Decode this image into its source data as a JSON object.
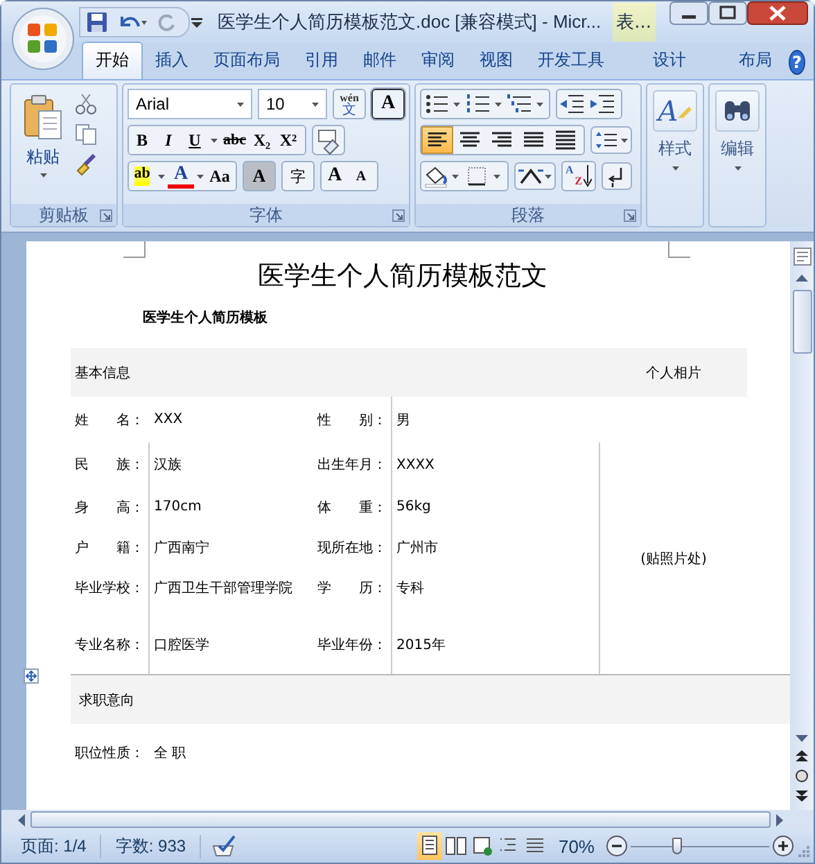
{
  "window": {
    "title": "医学生个人简历模板范文.doc [兼容模式] - Micr...",
    "context_group": "表..."
  },
  "tabs": [
    {
      "label": "开始",
      "selected": true,
      "kind": "main"
    },
    {
      "label": "插入",
      "selected": false,
      "kind": "main"
    },
    {
      "label": "页面布局",
      "selected": false,
      "kind": "main"
    },
    {
      "label": "引用",
      "selected": false,
      "kind": "main"
    },
    {
      "label": "邮件",
      "selected": false,
      "kind": "main"
    },
    {
      "label": "审阅",
      "selected": false,
      "kind": "main"
    },
    {
      "label": "视图",
      "selected": false,
      "kind": "main"
    },
    {
      "label": "开发工具",
      "selected": false,
      "kind": "main"
    },
    {
      "label": "设计",
      "selected": false,
      "kind": "context"
    },
    {
      "label": "布局",
      "selected": false,
      "kind": "context"
    }
  ],
  "ribbon": {
    "clipboard": {
      "label": "剪贴板",
      "paste": "粘贴"
    },
    "font": {
      "label": "字体",
      "font_name": "Arial",
      "font_size": "10",
      "phonetic_top": "wén",
      "phonetic_bottom": "文",
      "char_border": "A",
      "style_buttons": [
        "B",
        "I",
        "U",
        "abc",
        "X₂",
        "X²"
      ],
      "highlight": "ab",
      "font_color": "A",
      "change_case": "Aa",
      "char_shading": "A",
      "enclose": "字",
      "grow": "A",
      "shrink": "A"
    },
    "paragraph": {
      "label": "段落",
      "alignments": [
        {
          "selected": true
        },
        {
          "selected": false
        },
        {
          "selected": false
        },
        {
          "selected": false
        },
        {
          "selected": false
        }
      ],
      "sort_top": "A",
      "sort_bottom": "Z"
    },
    "styles": {
      "label": "样式",
      "icon_letter": "A"
    },
    "editing": {
      "label": "编辑"
    },
    "help": "?"
  },
  "document": {
    "title": "医学生个人简历模板范文",
    "subtitle": "医学生个人简历模板",
    "basic_info": {
      "header": "基本信息",
      "photo_header": "个人相片",
      "photo_hint": "(贴照片处)",
      "fields": [
        {
          "left_label": "姓　　名：",
          "left_value": "XXX",
          "right_label": "性　　别：",
          "right_value": "男"
        },
        {
          "left_label": "民　　族：",
          "left_value": "汉族",
          "right_label": "出生年月：",
          "right_value": "XXXX"
        },
        {
          "left_label": "身　　高：",
          "left_value": "170cm",
          "right_label": "体　　重：",
          "right_value": "56kg"
        },
        {
          "left_label": "户　　籍：",
          "left_value": "广西南宁",
          "right_label": "现所在地：",
          "right_value": "广州市"
        },
        {
          "left_label": "毕业学校：",
          "left_value": "广西卫生干部管理学院",
          "right_label": "学　　历：",
          "right_value": "专科"
        },
        {
          "left_label": "专业名称：",
          "left_value": "口腔医学",
          "right_label": "毕业年份：",
          "right_value": "2015年"
        }
      ]
    },
    "job_intent": {
      "header": "求职意向",
      "fields": [
        {
          "label": "职位性质：",
          "value": "全 职"
        }
      ]
    }
  },
  "status_bar": {
    "page": "页面: 1/4",
    "words": "字数: 933",
    "views": [
      {
        "selected": true
      },
      {
        "selected": false
      },
      {
        "selected": false
      },
      {
        "selected": false
      },
      {
        "selected": false
      }
    ],
    "zoom": "70%",
    "zoom_slider": {
      "level": 0.33
    }
  }
}
